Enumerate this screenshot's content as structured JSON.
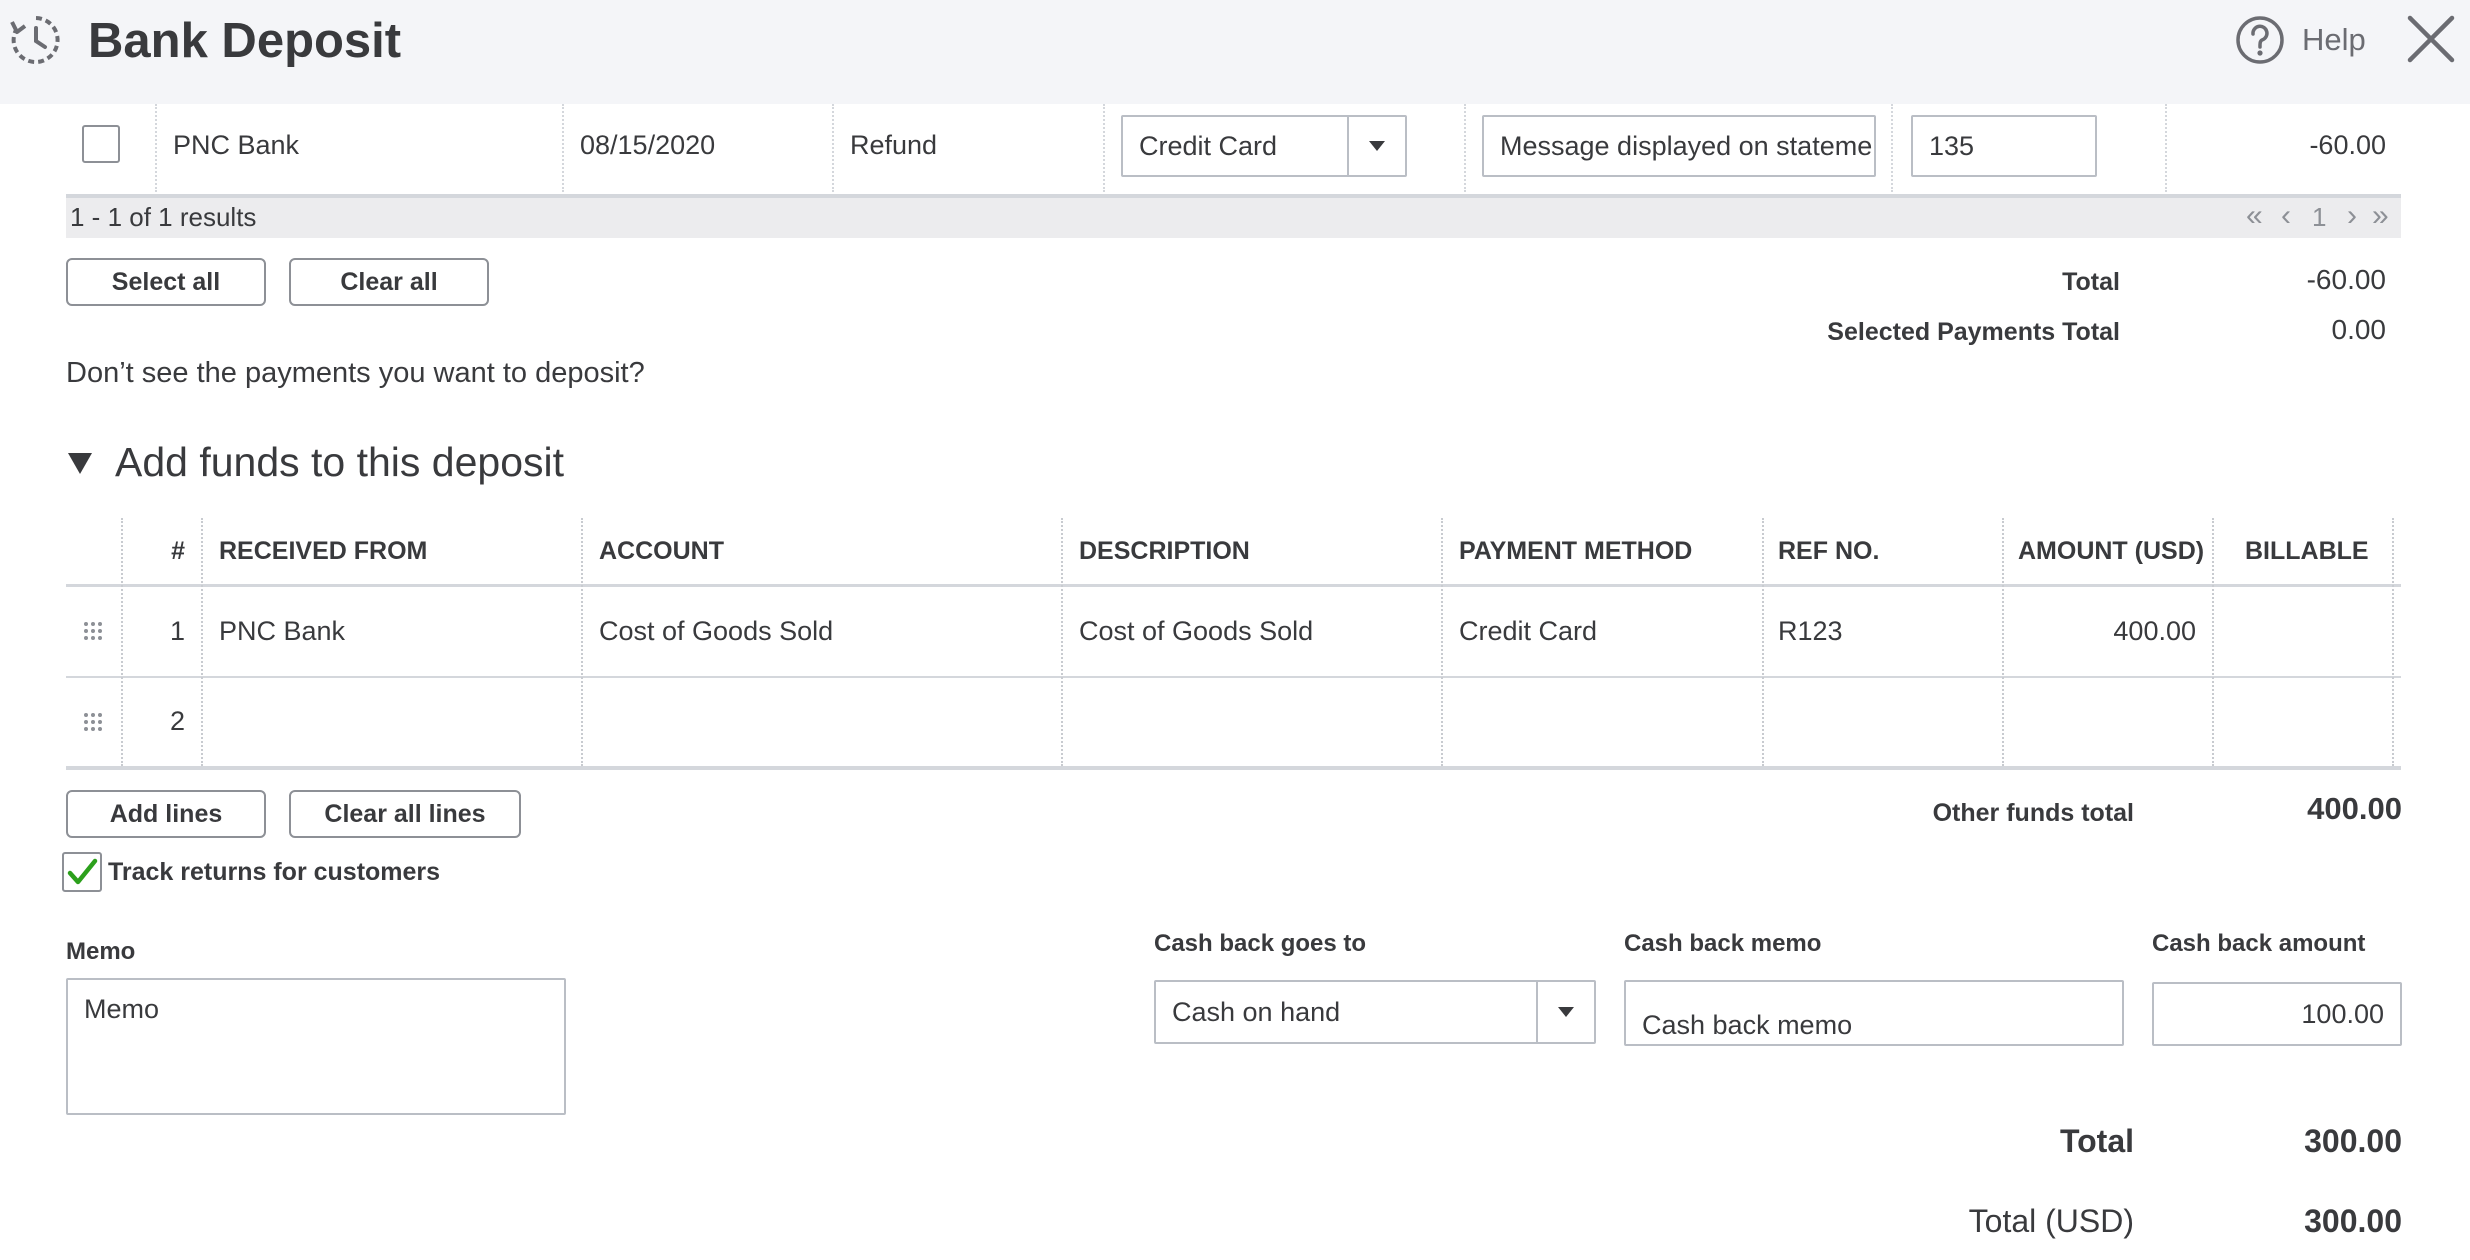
{
  "header": {
    "title": "Bank Deposit",
    "help_label": "Help"
  },
  "payments": {
    "row": {
      "name": "PNC Bank",
      "date": "08/15/2020",
      "type": "Refund",
      "payment_method": "Credit Card",
      "memo_placeholder": "Message displayed on statement",
      "ref_no": "135",
      "amount": "-60.00"
    },
    "results_text": "1 - 1 of 1 results",
    "pager": {
      "first": "«",
      "prev": "‹",
      "page": "1",
      "next": "›",
      "last": "»"
    },
    "select_all_label": "Select all",
    "clear_all_label": "Clear all",
    "total_label": "Total",
    "total_value": "-60.00",
    "selected_total_label": "Selected Payments Total",
    "selected_total_value": "0.00",
    "missing_link": "Don’t see the payments you want to deposit?"
  },
  "add_funds": {
    "section_title": "Add funds to this deposit",
    "columns": [
      "#",
      "RECEIVED FROM",
      "ACCOUNT",
      "DESCRIPTION",
      "PAYMENT METHOD",
      "REF NO.",
      "AMOUNT (USD)",
      "BILLABLE"
    ],
    "rows": [
      {
        "num": "1",
        "received_from": "PNC Bank",
        "account": "Cost of Goods Sold",
        "description": "Cost of Goods Sold",
        "payment_method": "Credit Card",
        "ref_no": "R123",
        "amount": "400.00",
        "billable": ""
      },
      {
        "num": "2",
        "received_from": "",
        "account": "",
        "description": "",
        "payment_method": "",
        "ref_no": "",
        "amount": "",
        "billable": ""
      }
    ],
    "add_lines_label": "Add lines",
    "clear_all_lines_label": "Clear all lines",
    "other_funds_label": "Other funds total",
    "other_funds_value": "400.00",
    "track_returns_label": "Track returns for customers",
    "track_returns_checked": true
  },
  "footer": {
    "memo_label": "Memo",
    "memo_placeholder": "Memo",
    "cash_back_goes_to_label": "Cash back goes to",
    "cash_back_goes_to_value": "Cash on hand",
    "cash_back_memo_label": "Cash back memo",
    "cash_back_memo_placeholder": "Cash back memo",
    "cash_back_amount_label": "Cash back amount",
    "cash_back_amount_value": "100.00",
    "total_label": "Total",
    "total_value": "300.00",
    "total_usd_label": "Total (USD)",
    "total_usd_value": "300.00"
  },
  "colors": {
    "header_bg": "#f4f5f8",
    "link": "#0077c5",
    "check_green": "#2ca01c",
    "text": "#393a3d"
  }
}
